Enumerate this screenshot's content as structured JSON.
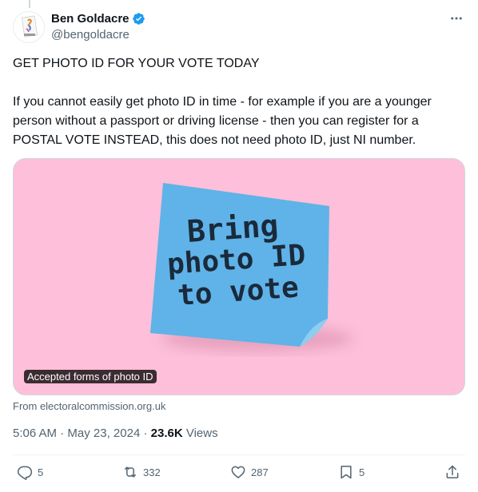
{
  "author": {
    "display_name": "Ben Goldacre",
    "handle": "@bengoldacre",
    "verified": true,
    "avatar_icon": "author-avatar-image"
  },
  "tweet": {
    "line1": "GET PHOTO ID FOR YOUR VOTE TODAY",
    "line2": "If you cannot easily get photo ID in time - for example if you are a younger person without a passport or driving license - then you can register for a POSTAL VOTE INSTEAD, this does not need photo ID, just NI number."
  },
  "media": {
    "note_text": [
      "Bring",
      "photo ID",
      "to vote"
    ],
    "label": "Accepted forms of photo ID",
    "background_color": "#fdbfd9",
    "note_color": "#5fb3e8"
  },
  "card_source": "From electoralcommission.org.uk",
  "meta": {
    "time": "5:06 AM",
    "separator1": " · ",
    "date": "May 23, 2024",
    "separator2": " · ",
    "views_count": "23.6K",
    "views_label": " Views"
  },
  "actions": {
    "replies": "5",
    "reposts": "332",
    "likes": "287",
    "bookmarks": "5"
  },
  "colors": {
    "accent": "#1d9bf0",
    "secondary_text": "#536471"
  }
}
